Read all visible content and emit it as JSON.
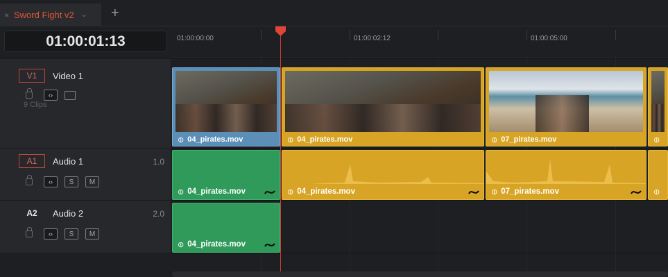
{
  "tab": {
    "close": "×",
    "title": "Sword Fight v2",
    "chevron": "⌄",
    "add": "+"
  },
  "timecode": "01:00:01:13",
  "ruler": {
    "labels": [
      "01:00:00:00",
      "01:00:02:12",
      "01:00:05:00"
    ]
  },
  "tracks": {
    "video1": {
      "id": "V1",
      "name": "Video 1",
      "clip_count": "9 Clips"
    },
    "audio1": {
      "id": "A1",
      "name": "Audio 1",
      "volume": "1.0",
      "solo": "S",
      "mute": "M"
    },
    "audio2": {
      "id": "A2",
      "name": "Audio 2",
      "volume": "2.0",
      "solo": "S",
      "mute": "M"
    }
  },
  "clips": {
    "v1": [
      "04_pirates.mov",
      "04_pirates.mov",
      "07_pirates.mov"
    ],
    "a1": [
      "04_pirates.mov",
      "04_pirates.mov",
      "07_pirates.mov"
    ],
    "a2": [
      "04_pirates.mov"
    ]
  },
  "colors": {
    "playhead": "#d23b33",
    "selected_clip": "#5b8fb8",
    "video_clip": "#d8a425",
    "audio_linked": "#2f9a5a",
    "audio_clip": "#d8a425"
  },
  "icons": {
    "link": "link-icon",
    "lock": "lock-icon",
    "auto_select": "auto-select-icon",
    "video_toggle": "video-toggle-icon",
    "fade_curve": "fade-curve-icon"
  }
}
